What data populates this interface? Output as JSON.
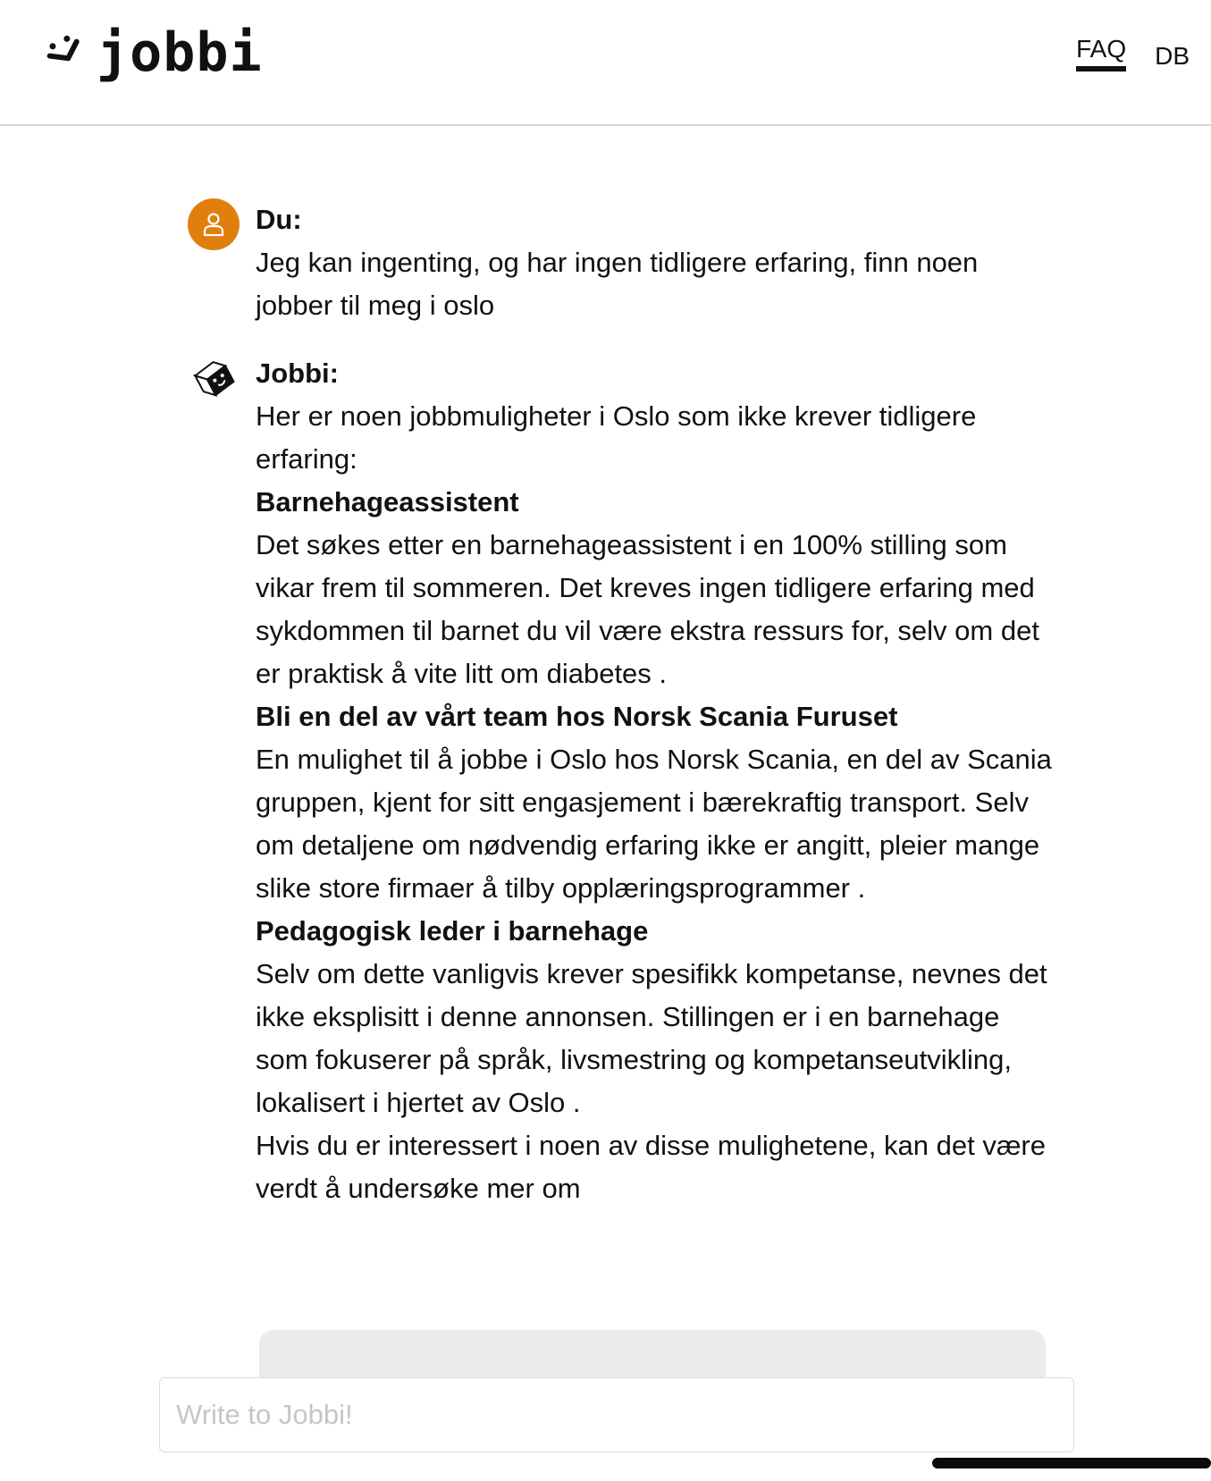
{
  "header": {
    "logo_text": "jobbi",
    "nav": [
      {
        "label": "FAQ",
        "active": true
      },
      {
        "label": "DB",
        "active": false
      }
    ]
  },
  "chat": {
    "messages": [
      {
        "sender": "Du:",
        "role": "user",
        "avatar_icon": "user-icon",
        "lines": [
          "Jeg kan ingenting, og har ingen tidligere erfaring, finn noen jobber til meg i oslo"
        ]
      },
      {
        "sender": "Jobbi:",
        "role": "bot",
        "avatar_icon": "jobbi-cube-icon",
        "intro": "Her er noen jobbmuligheter i Oslo som ikke krever tidligere erfaring:",
        "jobs": [
          {
            "title": "Barnehageassistent",
            "description": "Det søkes etter en barnehageassistent i en 100% stilling som vikar frem til sommeren. Det kreves ingen tidligere erfaring med sykdommen til barnet du vil være ekstra ressurs for, selv om det er praktisk å vite litt om diabetes ."
          },
          {
            "title": "Bli en del av vårt team hos Norsk Scania Furuset",
            "description": "En mulighet til å jobbe i Oslo hos Norsk Scania, en del av Scania gruppen, kjent for sitt engasjement i bærekraftig transport. Selv om detaljene om nødvendig erfaring ikke er angitt, pleier mange slike store firmaer å tilby opplæringsprogrammer ."
          },
          {
            "title": "Pedagogisk leder i barnehage",
            "description": "Selv om dette vanligvis krever spesifikk kompetanse, nevnes det ikke eksplisitt i denne annonsen. Stillingen er i en barnehage som fokuserer på språk, livsmestring og kompetanseutvikling, lokalisert i hjertet av Oslo ."
          }
        ],
        "outro": "Hvis du er interessert i noen av disse mulighetene, kan det være verdt å undersøke mer om"
      }
    ]
  },
  "composer": {
    "placeholder": "Write to Jobbi!",
    "value": ""
  },
  "colors": {
    "user_avatar": "#e17f0e",
    "text": "#111111",
    "divider": "#d9d9d9",
    "shelf": "#ebebee"
  }
}
